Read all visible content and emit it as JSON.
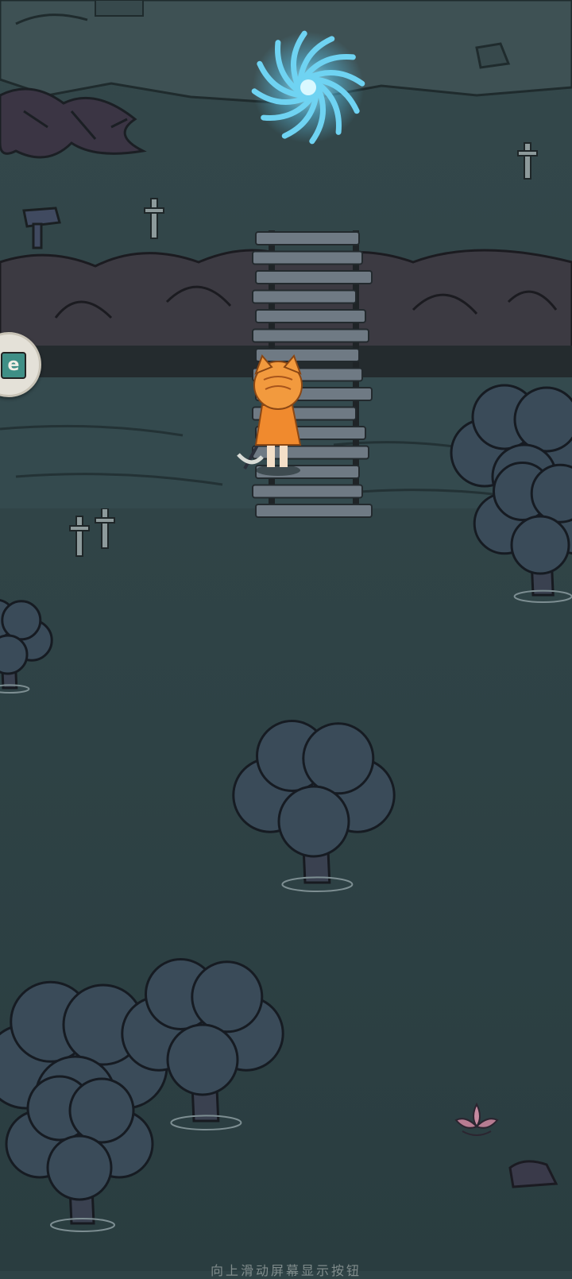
{
  "hint": {
    "text": "向上滑动屏幕显示按钮"
  },
  "side_button": {
    "label": "e"
  },
  "colors": {
    "water": "#2f4346",
    "water_light": "#3a5053",
    "cliff": "#3c3a42",
    "tree_canopy": "#3a4b59",
    "portal": "#6fd3f2",
    "character": "#f08a2e"
  },
  "icons": {
    "portal": "swirl-portal-icon",
    "lotus": "lotus-icon"
  }
}
